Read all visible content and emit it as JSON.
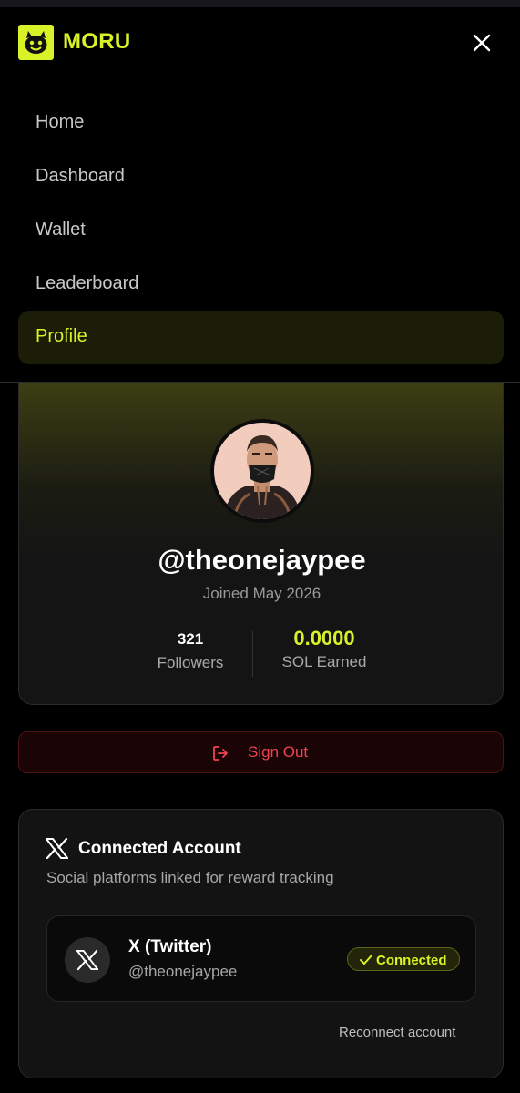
{
  "header": {
    "brand": "MORU",
    "logo_icon": "moru-logo-icon",
    "close_icon": "close-icon"
  },
  "nav": {
    "items": [
      {
        "label": "Home",
        "active": false
      },
      {
        "label": "Dashboard",
        "active": false
      },
      {
        "label": "Wallet",
        "active": false
      },
      {
        "label": "Leaderboard",
        "active": false
      },
      {
        "label": "Profile",
        "active": true
      }
    ]
  },
  "profile": {
    "username": "@theonejaypee",
    "joined": "Joined May 2026",
    "stats": [
      {
        "value": "321",
        "label": "Followers"
      },
      {
        "value": "0.0000",
        "label": "SOL Earned"
      }
    ]
  },
  "signout": {
    "label": "Sign Out",
    "icon": "logout-icon"
  },
  "connected": {
    "title": "Connected Account",
    "subtitle": "Social platforms linked for reward tracking",
    "account": {
      "platform": "X (Twitter)",
      "handle": "@theonejaypee",
      "status": "Connected"
    },
    "reconnect": "Reconnect account"
  },
  "colors": {
    "accent": "#d9f227",
    "danger": "#ef4450",
    "background": "#000000"
  }
}
